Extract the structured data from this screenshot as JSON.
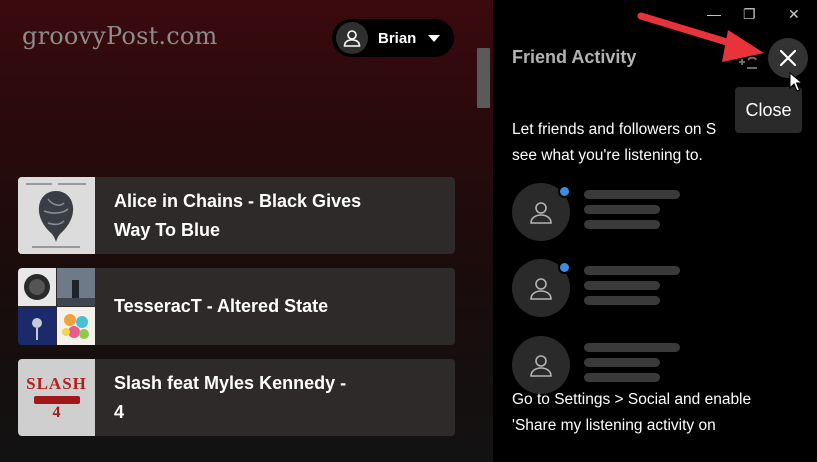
{
  "watermark": "groovyPost.com",
  "header": {
    "user_name": "Brian"
  },
  "playlists": [
    {
      "line1": "Alice in Chains - Black Gives",
      "line2": "Way To Blue"
    },
    {
      "line1": "TesseracT - Altered State",
      "line2": ""
    },
    {
      "line1": "Slash feat Myles Kennedy -",
      "line2": "4"
    }
  ],
  "album_art": {
    "slash_text": "SLASH",
    "slash_num": "4"
  },
  "friend_activity": {
    "title": "Friend Activity",
    "close_tooltip": "Close",
    "description_line1": "Let friends and followers on S",
    "description_line2": "see what you're listening to.",
    "bottom_line1": "Go to Settings > Social and enable",
    "bottom_line2": "'Share my listening activity on"
  },
  "window_controls": {
    "minimize": "—",
    "restore": "❐",
    "close": "✕"
  },
  "colors": {
    "accent_red": "#e8333a",
    "online_dot": "#3b8de0"
  },
  "icons": [
    "user-icon",
    "caret-down-icon",
    "add-friend-icon",
    "close-icon",
    "mouse-cursor-icon",
    "annotation-arrow"
  ]
}
